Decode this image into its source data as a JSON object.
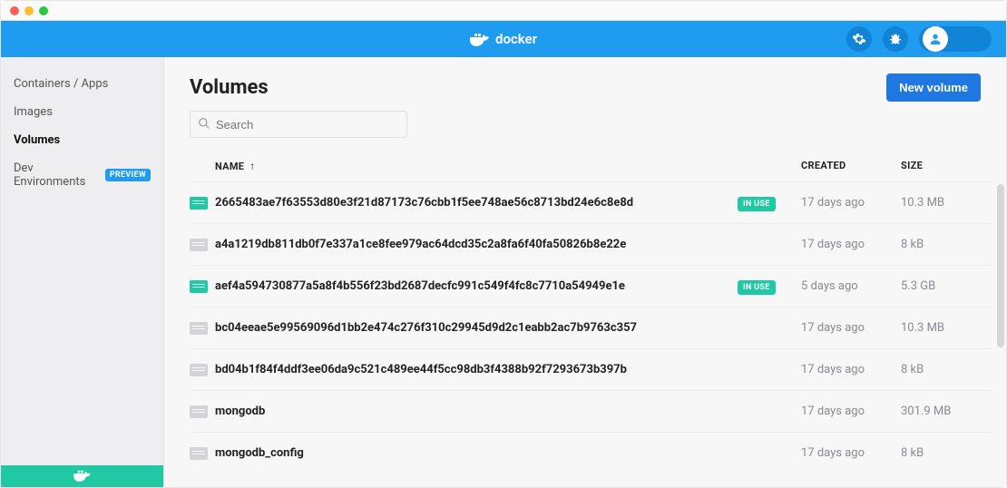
{
  "app": {
    "name": "docker"
  },
  "sidebar": {
    "items": [
      {
        "label": "Containers / Apps"
      },
      {
        "label": "Images"
      },
      {
        "label": "Volumes"
      },
      {
        "label": "Dev Environments",
        "badge": "PREVIEW"
      }
    ]
  },
  "main": {
    "title": "Volumes",
    "new_button_label": "New volume",
    "search_placeholder": "Search"
  },
  "table": {
    "headers": {
      "name": "NAME",
      "created": "CREATED",
      "size": "SIZE"
    },
    "rows": [
      {
        "name": "2665483ae7f63553d80e3f21d87173c76cbb1f5ee748ae56c8713bd24e6c8e8d",
        "in_use": true,
        "created": "17 days ago",
        "size": "10.3 MB"
      },
      {
        "name": "a4a1219db811db0f7e337a1ce8fee979ac64dcd35c2a8fa6f40fa50826b8e22e",
        "in_use": false,
        "created": "17 days ago",
        "size": "8 kB"
      },
      {
        "name": "aef4a594730877a5a8f4b556f23bd2687decfc991c549f4fc8c7710a54949e1e",
        "in_use": true,
        "created": "5 days ago",
        "size": "5.3 GB"
      },
      {
        "name": "bc04eeae5e99569096d1bb2e474c276f310c29945d9d2c1eabb2ac7b9763c357",
        "in_use": false,
        "created": "17 days ago",
        "size": "10.3 MB"
      },
      {
        "name": "bd04b1f84f4ddf3ee06da9c521c489ee44f5cc98db3f4388b92f7293673b397b",
        "in_use": false,
        "created": "17 days ago",
        "size": "8 kB"
      },
      {
        "name": "mongodb",
        "in_use": false,
        "created": "17 days ago",
        "size": "301.9 MB"
      },
      {
        "name": "mongodb_config",
        "in_use": false,
        "created": "17 days ago",
        "size": "8 kB"
      }
    ],
    "in_use_label": "IN USE"
  }
}
